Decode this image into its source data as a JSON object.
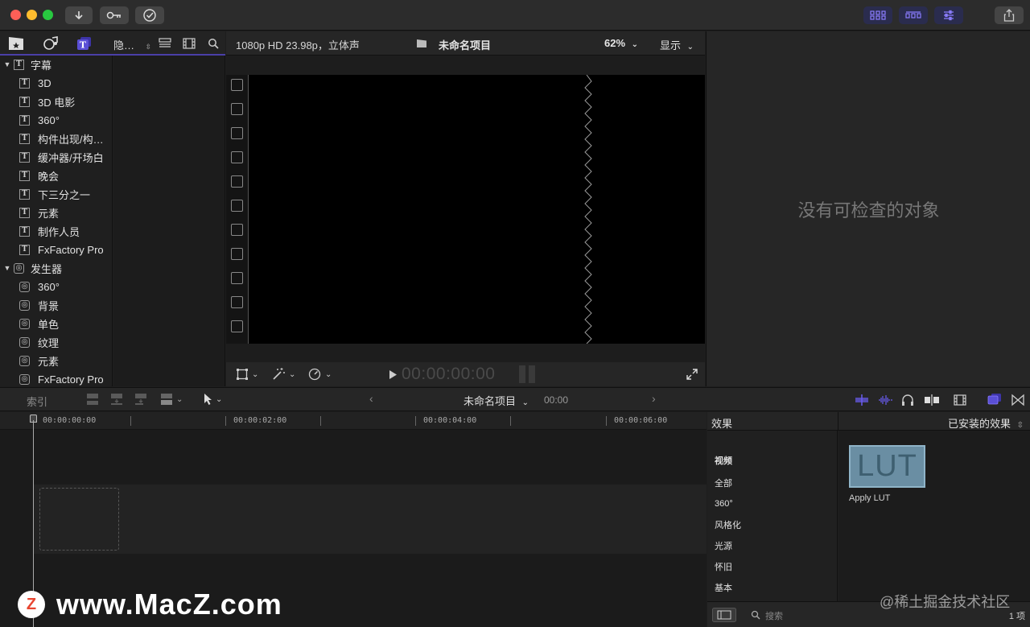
{
  "titlebar": {
    "import_icon": "download-arrow-icon",
    "keywords_icon": "key-icon",
    "background_tasks_icon": "check-circle-icon"
  },
  "library": {
    "toolbar": {
      "filter_label": "隐…"
    },
    "titles_group": {
      "label": "字幕",
      "items": [
        "3D",
        "3D 电影",
        "360°",
        "构件出现/构…",
        "缓冲器/开场白",
        "晚会",
        "下三分之一",
        "元素",
        "制作人员",
        "FxFactory Pro"
      ]
    },
    "generators_group": {
      "label": "发生器",
      "items": [
        "360°",
        "背景",
        "单色",
        "纹理",
        "元素",
        "FxFactory Pro"
      ]
    }
  },
  "viewer": {
    "format": "1080p HD 23.98p，立体声",
    "project_name": "未命名项目",
    "zoom": "62%",
    "display_menu": "显示",
    "timecode": "00:00:00:00"
  },
  "inspector": {
    "empty_message": "没有可检查的对象"
  },
  "timeline": {
    "index_label": "索引",
    "project_name": "未命名项目",
    "duration": "00:00",
    "ruler_labels": [
      "00:00:00:00",
      "00:00:02:00",
      "00:00:04:00",
      "00:00:06:00"
    ]
  },
  "effects": {
    "title": "效果",
    "installed_label": "已安装的效果",
    "categories": [
      "视频",
      "全部",
      "360°",
      "风格化",
      "光源",
      "怀旧",
      "基本"
    ],
    "thumbnail_text": "LUT",
    "items": [
      {
        "name": "Apply LUT"
      }
    ],
    "search_placeholder": "搜索",
    "count": "1 项"
  },
  "watermarks": {
    "site": "www.MacZ.com",
    "logo_letter": "Z",
    "juejin": "@稀土掘金技术社区"
  },
  "colors": {
    "accent": "#5a4fd6",
    "lut_bg": "#6a8ea3"
  }
}
